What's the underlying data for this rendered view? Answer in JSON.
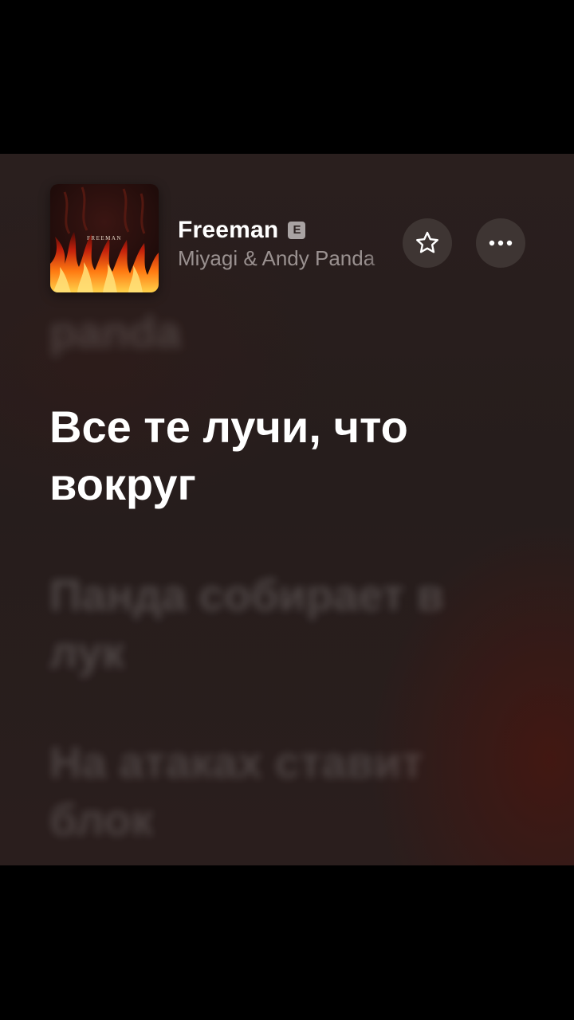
{
  "track": {
    "title": "Freeman",
    "explicit_badge": "E",
    "artist": "Miyagi & Andy Panda",
    "artwork_text": "FREEMAN"
  },
  "actions": {
    "favorite_icon": "star-icon",
    "more_icon": "ellipsis-icon"
  },
  "lyrics": {
    "previous": "panda",
    "current": "Все те лучи, что вокруг",
    "next": [
      "Панда собирает в лук",
      "На атаках ставит блок"
    ]
  },
  "colors": {
    "background": "#261d1c",
    "current_lyric": "#ffffff",
    "button_bg": "#3e3533",
    "artist_text": "#9a9190"
  }
}
